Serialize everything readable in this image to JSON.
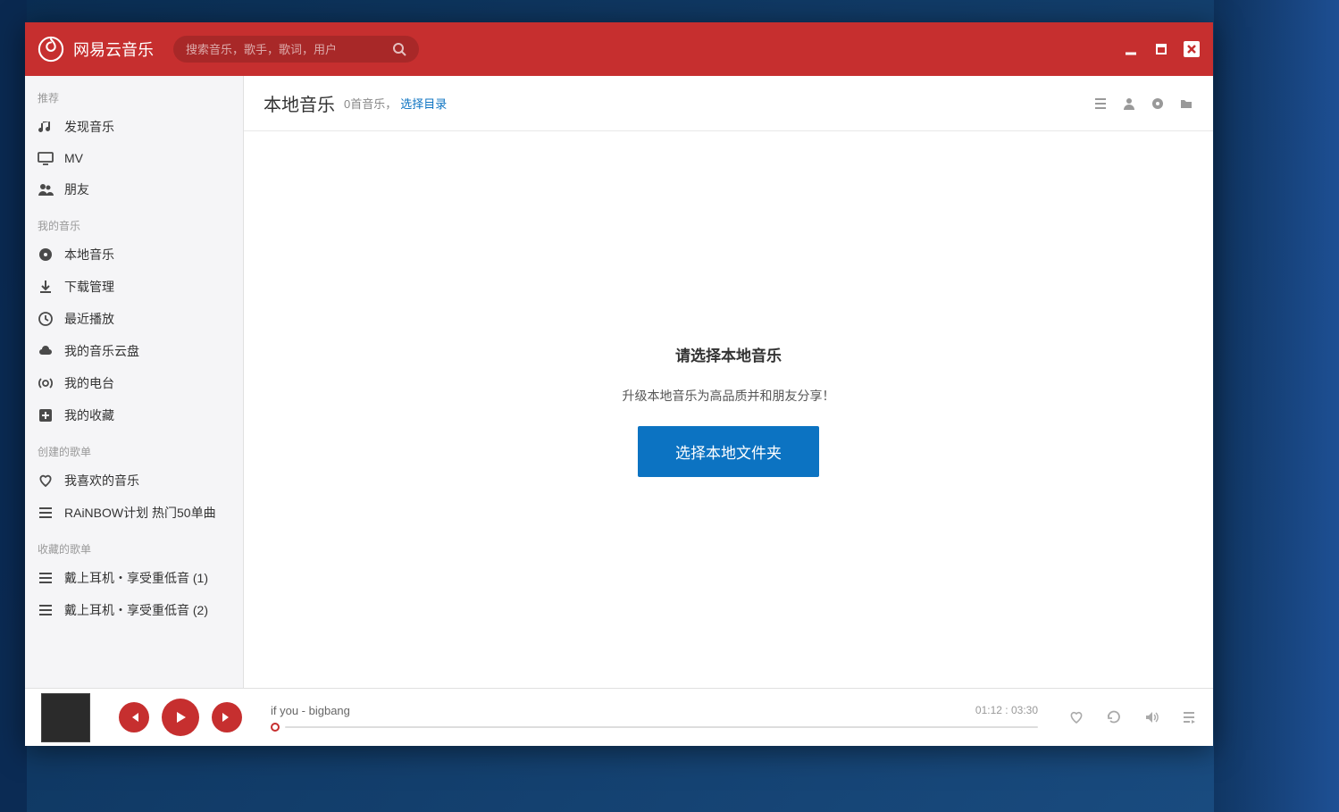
{
  "app": {
    "title": "网易云音乐"
  },
  "search": {
    "placeholder": "搜索音乐，歌手，歌词，用户"
  },
  "sidebar": {
    "sections": [
      {
        "title": "推荐",
        "items": [
          {
            "label": "发现音乐"
          },
          {
            "label": "MV"
          },
          {
            "label": "朋友"
          }
        ]
      },
      {
        "title": "我的音乐",
        "items": [
          {
            "label": "本地音乐"
          },
          {
            "label": "下载管理"
          },
          {
            "label": "最近播放"
          },
          {
            "label": "我的音乐云盘"
          },
          {
            "label": "我的电台"
          },
          {
            "label": "我的收藏"
          }
        ]
      },
      {
        "title": "创建的歌单",
        "items": [
          {
            "label": "我喜欢的音乐"
          },
          {
            "label": "RAiNBOW计划 热门50单曲"
          }
        ]
      },
      {
        "title": "收藏的歌单",
        "items": [
          {
            "label": "戴上耳机・享受重低音  (1)"
          },
          {
            "label": "戴上耳机・享受重低音  (2)"
          }
        ]
      }
    ]
  },
  "content": {
    "title": "本地音乐",
    "count_text": "0首音乐，",
    "select_dir_link": "选择目录",
    "prompt_title": "请选择本地音乐",
    "prompt_sub": "升级本地音乐为高品质并和朋友分享！",
    "select_btn": "选择本地文件夹"
  },
  "player": {
    "track": "if you - bigbang",
    "time_current": "01:12",
    "time_total": "03:30"
  }
}
